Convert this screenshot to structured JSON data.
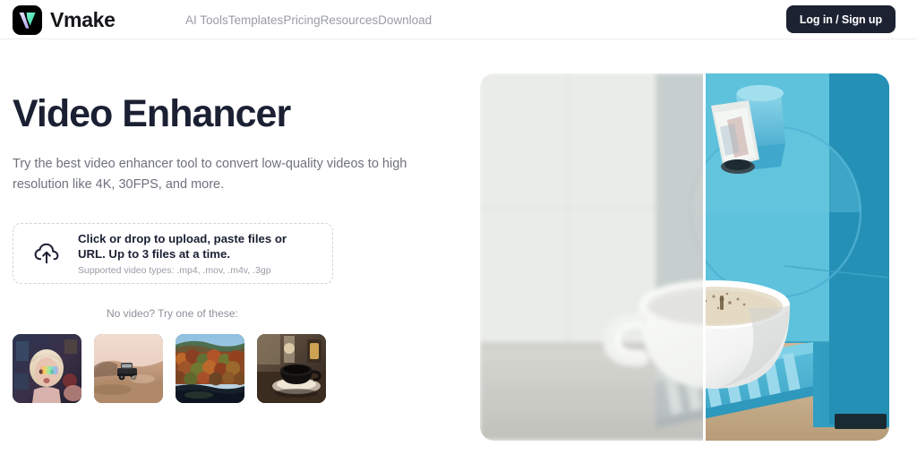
{
  "header": {
    "brand": {
      "name": "Vmake",
      "logo_icon": "vmake-logo-icon"
    },
    "nav": [
      {
        "label": "AI Tools"
      },
      {
        "label": "Templates"
      },
      {
        "label": "Pricing"
      },
      {
        "label": "Resources"
      },
      {
        "label": "Download"
      }
    ],
    "login_button": "Log in / Sign up",
    "colors": {
      "button_bg": "#1c2232",
      "nav_text": "#9a9ca5",
      "border": "#eeeef0"
    }
  },
  "hero": {
    "title": "Video Enhancer",
    "subtitle": "Try the best video enhancer tool to convert low-quality videos to high resolution like 4K, 30FPS, and more.",
    "title_color": "#1b2033",
    "subtitle_color": "#6f717d"
  },
  "upload": {
    "icon": "cloud-upload-icon",
    "primary_text": "Click or drop to upload, paste files or URL. Up to 3 files at a time.",
    "supported_text": "Supported video types: .mp4, .mov, .m4v, .3gp",
    "border_color": "#d2d4da"
  },
  "samples": {
    "label": "No video? Try one of these:",
    "items": [
      {
        "name": "portrait-rainbow-light-thumbnail",
        "alt": "Portrait of a person with rainbow light on face"
      },
      {
        "name": "desert-truck-thumbnail",
        "alt": "Truck driving in desert dunes"
      },
      {
        "name": "autumn-forest-thumbnail",
        "alt": "Autumn forest hillside"
      },
      {
        "name": "coffee-cup-thumbnail",
        "alt": "Dark coffee cup on saucer in cafe"
      }
    ]
  },
  "comparison": {
    "name": "before-after-comparison",
    "alt": "Espresso machine pouring coffee into a white cup, before and after enhancement",
    "divider_label": "comparison-slider-handle",
    "before_side": "left",
    "after_side": "right"
  }
}
